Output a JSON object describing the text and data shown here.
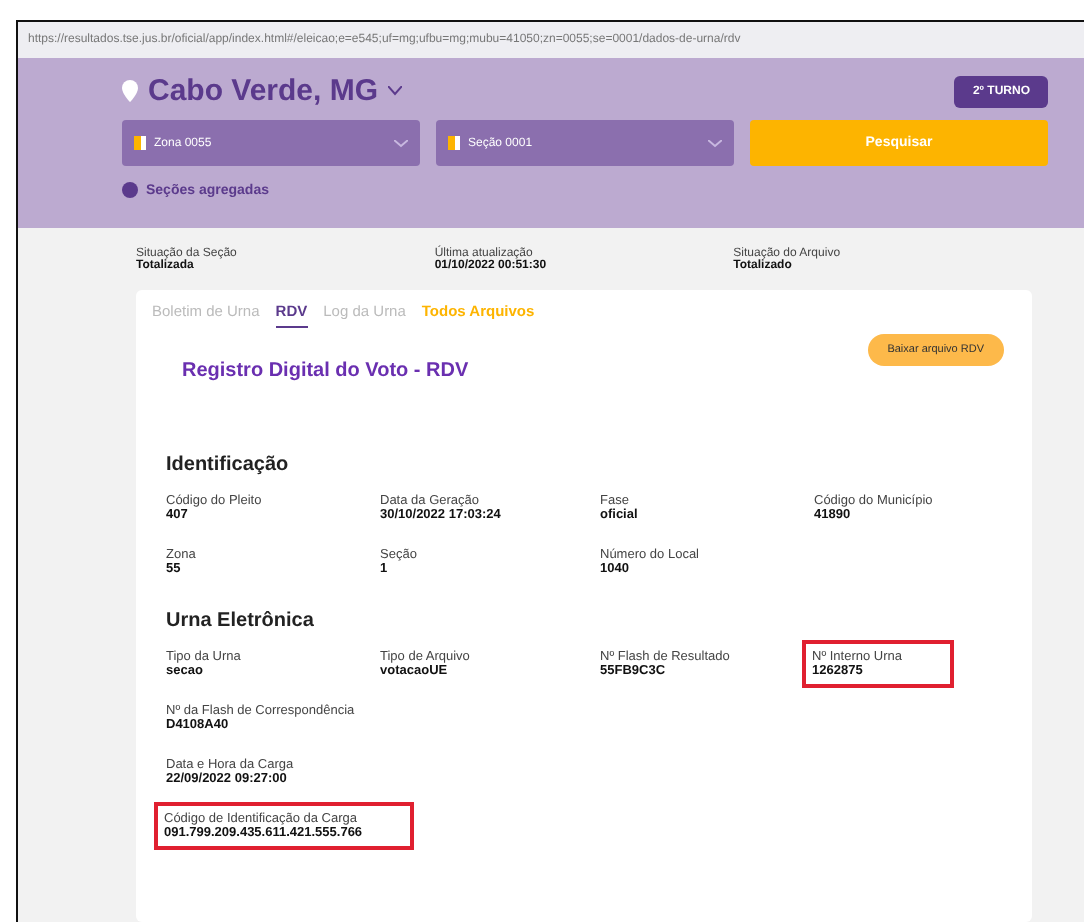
{
  "address_bar": {
    "url": "https://resultados.tse.jus.br/oficial/app/index.html#/eleicao;e=e545;uf=mg;ufbu=mg;mubu=41050;zn=0055;se=0001/dados-de-urna/rdv"
  },
  "header": {
    "location": "Cabo Verde, MG",
    "round_button": "2º TURNO",
    "zone_select": "Zona 0055",
    "section_select": "Seção 0001",
    "search_button": "Pesquisar",
    "aggregated_link": "Seções agregadas"
  },
  "status": [
    {
      "label": "Situação da Seção",
      "value": "Totalizada"
    },
    {
      "label": "Última atualização",
      "value": "01/10/2022 00:51:30"
    },
    {
      "label": "Situação do Arquivo",
      "value": "Totalizado"
    }
  ],
  "tabs": [
    {
      "label": "Boletim de Urna",
      "kind": "tab",
      "selected": false
    },
    {
      "label": "RDV",
      "kind": "tab",
      "selected": true
    },
    {
      "label": "Log da Urna",
      "kind": "tab",
      "selected": false
    },
    {
      "label": "Todos Arquivos",
      "kind": "link",
      "selected": false
    }
  ],
  "download_button": "Baixar arquivo RDV",
  "title": "Registro Digital do Voto - RDV",
  "sections": [
    {
      "heading": "Identificação",
      "rows": [
        [
          {
            "label": "Código do Pleito",
            "value": "407",
            "highlighted": false
          },
          {
            "label": "Data da Geração",
            "value": "30/10/2022 17:03:24",
            "highlighted": false
          },
          {
            "label": "Fase",
            "value": "oficial",
            "highlighted": false
          },
          {
            "label": "Código do Município",
            "value": "41890",
            "highlighted": false
          }
        ],
        [
          {
            "label": "Zona",
            "value": "55",
            "highlighted": false
          },
          {
            "label": "Seção",
            "value": "1",
            "highlighted": false
          },
          {
            "label": "Número do Local",
            "value": "1040",
            "highlighted": false
          }
        ]
      ]
    },
    {
      "heading": "Urna Eletrônica",
      "rows": [
        [
          {
            "label": "Tipo da Urna",
            "value": "secao",
            "highlighted": false
          },
          {
            "label": "Tipo de Arquivo",
            "value": "votacaoUE",
            "highlighted": false
          },
          {
            "label": "Nº Flash de Resultado",
            "value": "55FB9C3C",
            "highlighted": false
          },
          {
            "label": "Nº Interno Urna",
            "value": "1262875",
            "highlighted": true
          }
        ],
        [
          {
            "label": "Nº da Flash de Correspondência",
            "value": "D4108A40",
            "highlighted": false
          }
        ],
        [
          {
            "label": "Data e Hora da Carga",
            "value": "22/09/2022 09:27:00",
            "highlighted": false
          }
        ],
        [
          {
            "label": "Código de Identificação da Carga",
            "value": "091.799.209.435.611.421.555.766",
            "highlighted": true
          }
        ]
      ]
    }
  ]
}
